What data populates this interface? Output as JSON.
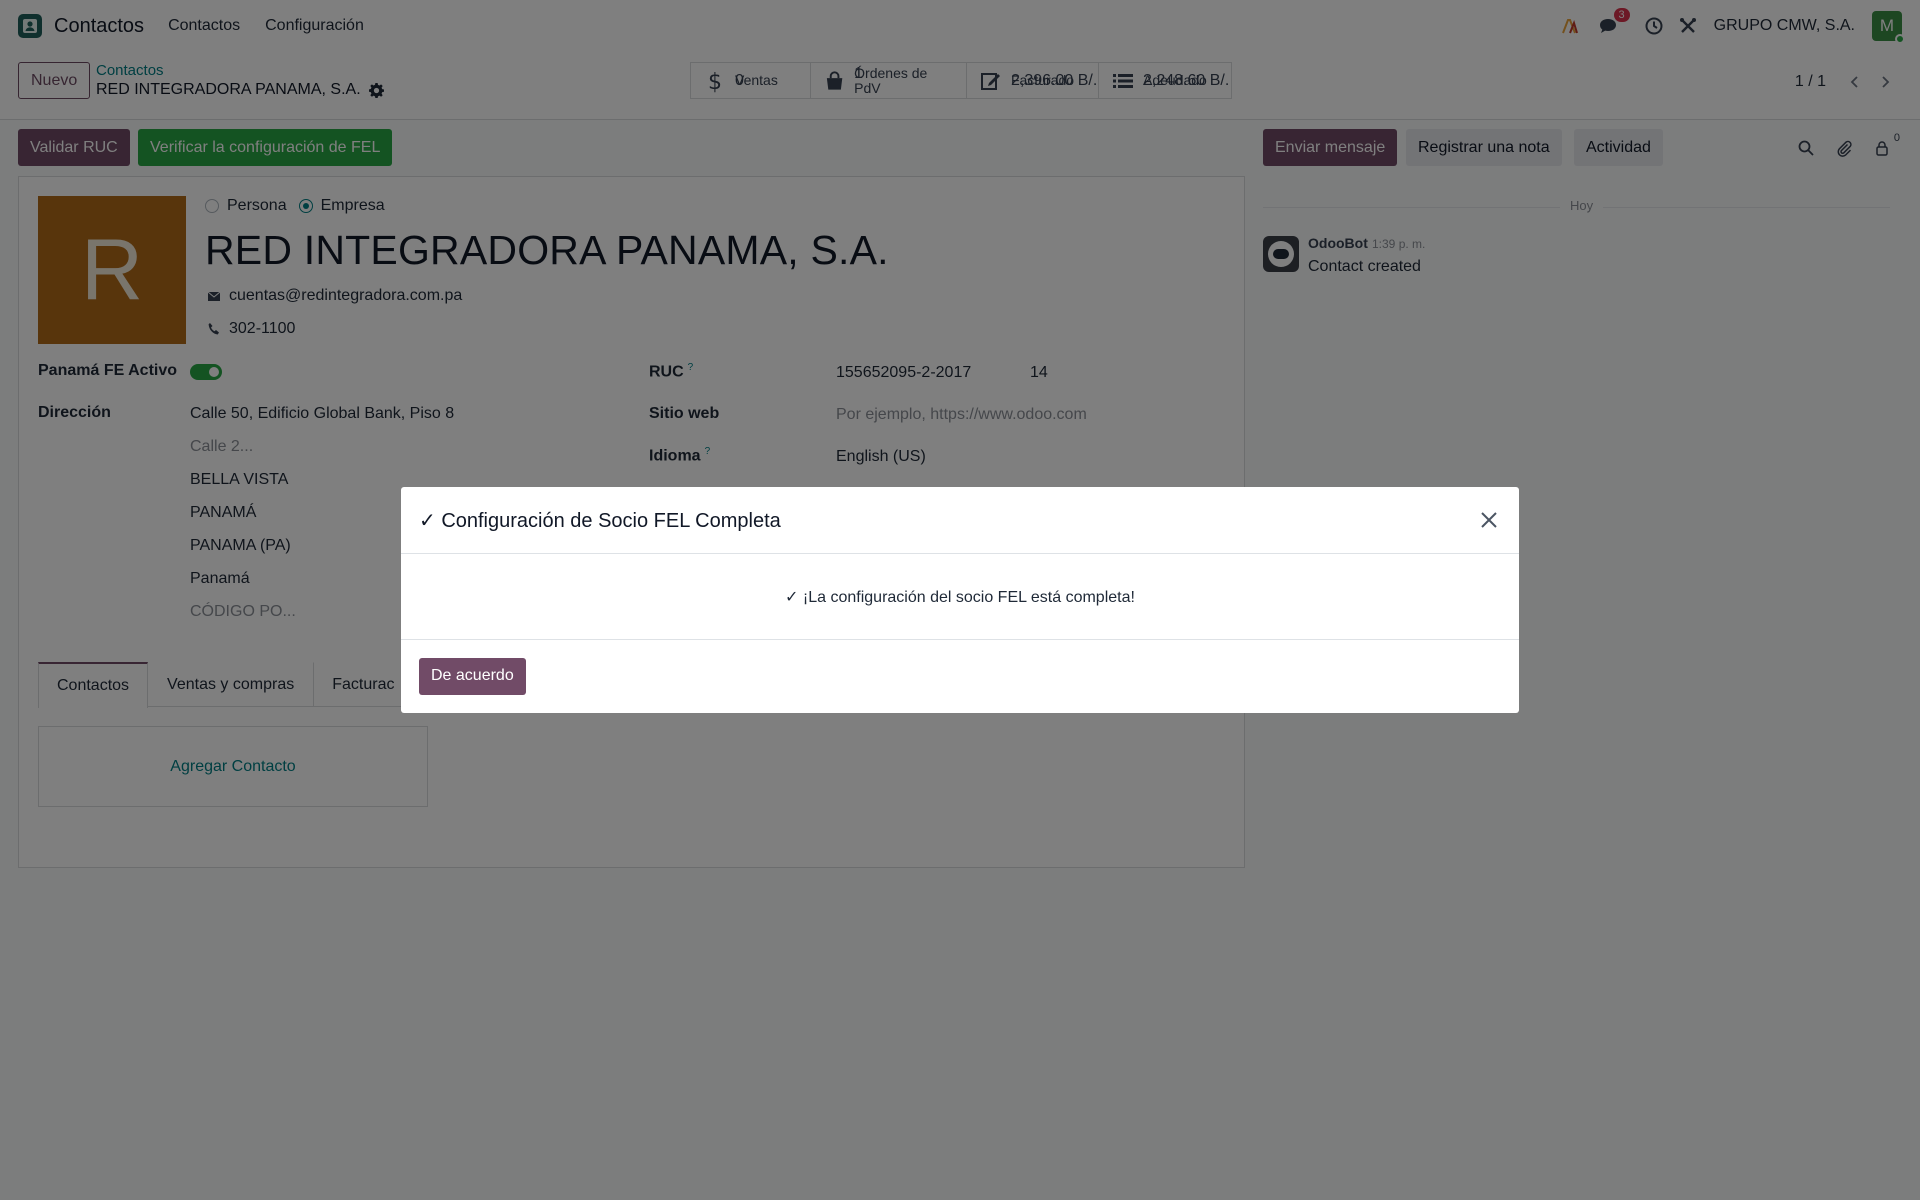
{
  "navbar": {
    "app_name": "Contactos",
    "menu": [
      "Contactos",
      "Configuración"
    ],
    "messages_count": "3",
    "company": "GRUPO CMW, S.A.",
    "user_initial": "M"
  },
  "control": {
    "new_label": "Nuevo",
    "breadcrumb_parent": "Contactos",
    "breadcrumb_current": "RED INTEGRADORA PANAMA, S.A.",
    "stats": [
      {
        "label": "Ventas",
        "value": "0",
        "icon": "dollar-icon"
      },
      {
        "label": "Órdenes de PdV",
        "value": "1",
        "icon": "shopping-bag-icon"
      },
      {
        "label": "Facturado",
        "value": "2,396.00 B/.",
        "icon": "invoice-edit-icon"
      },
      {
        "label": "Adeudado",
        "value": "2,248.60 B/.",
        "icon": "list-icon"
      }
    ],
    "pager": "1 / 1"
  },
  "actions": {
    "validate_ruc": "Validar RUC",
    "verify_fel": "Verificar la configuración de FEL",
    "send_message": "Enviar mensaje",
    "log_note": "Registrar una nota",
    "activity": "Actividad",
    "followers_count": "0"
  },
  "form": {
    "avatar_letter": "R",
    "type_person": "Persona",
    "type_company": "Empresa",
    "name": "RED INTEGRADORA PANAMA, S.A.",
    "email": "cuentas@redintegradora.com.pa",
    "phone": "302-1100",
    "fe_active_label": "Panamá FE Activo",
    "address_label": "Dirección",
    "street": "Calle 50, Edificio Global Bank, Piso 8",
    "street2_placeholder": "Calle 2...",
    "district": "BELLA VISTA",
    "city": "PANAMÁ",
    "state": "PANAMA (PA)",
    "country": "Panamá",
    "zip_placeholder": "CÓDIGO PO...",
    "ruc_label": "RUC",
    "ruc_help": "?",
    "ruc_value": "155652095-2-2017",
    "dv_value": "14",
    "website_label": "Sitio web",
    "website_placeholder": "Por ejemplo, https://www.odoo.com",
    "lang_label": "Idioma",
    "lang_help": "?",
    "lang_value": "English (US)",
    "tabs": [
      "Contactos",
      "Ventas y compras",
      "Facturac"
    ],
    "add_contact": "Agregar Contacto"
  },
  "chatter": {
    "separator": "Hoy",
    "author": "OdooBot",
    "time": "1:39 p. m.",
    "message": "Contact created"
  },
  "modal": {
    "title": "✓ Configuración de Socio FEL Completa",
    "body": "✓ ¡La configuración del socio FEL está completa!",
    "ok_label": "De acuerdo"
  },
  "colors": {
    "primary": "#714b67",
    "success": "#28a745",
    "link": "#017e84",
    "avatar_bg": "#b06a18"
  }
}
